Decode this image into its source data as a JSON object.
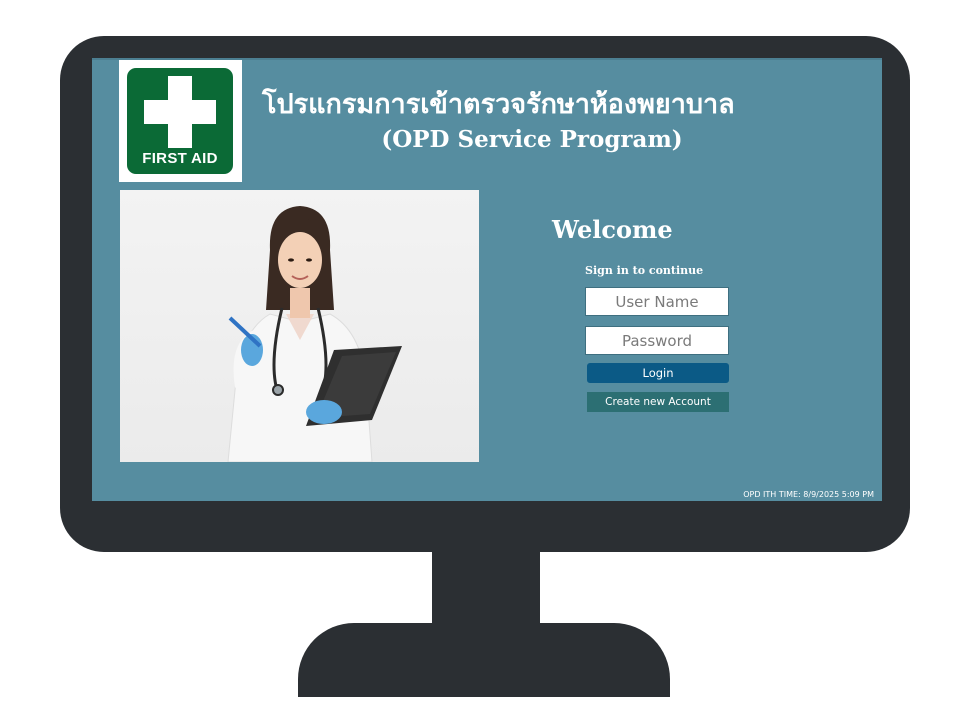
{
  "app": {
    "title_thai": "โปรแกรมการเข้าตรวจรักษาห้องพยาบาล",
    "title_english": "(OPD Service Program)"
  },
  "logo": {
    "text": "FIRST AID",
    "icon": "first-aid-cross-icon",
    "color": "#0b6a36"
  },
  "login": {
    "welcome": "Welcome",
    "subtitle": "Sign in to continue",
    "username_placeholder": "User Name",
    "password_placeholder": "Password",
    "login_label": "Login",
    "create_account_label": "Create new Account"
  },
  "status": {
    "text": "OPD ITH TIME: 8/9/2025 5:09 PM"
  },
  "colors": {
    "screen_background": "#568da0",
    "monitor_frame": "#2b2f33",
    "login_button": "#0b5a86",
    "create_button": "#2c6f73"
  }
}
